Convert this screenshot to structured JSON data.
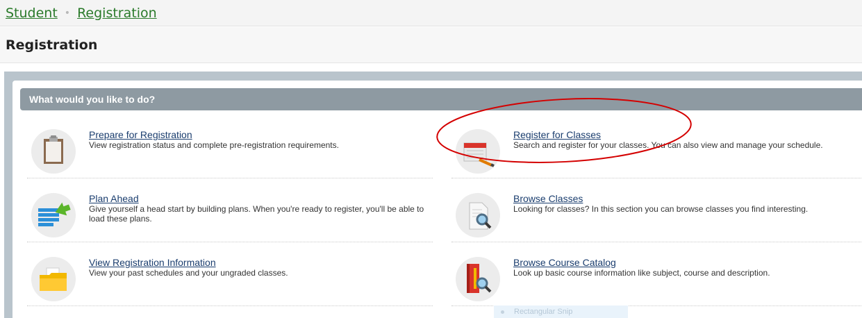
{
  "breadcrumb": {
    "items": [
      {
        "label": "Student"
      },
      {
        "label": "Registration"
      }
    ],
    "separator": "•"
  },
  "page_title": "Registration",
  "panel": {
    "header": "What would you like to do?"
  },
  "actions": {
    "prepare": {
      "title": "Prepare for Registration",
      "description": "View registration status and complete pre-registration requirements.",
      "icon": "clipboard-icon"
    },
    "register": {
      "title": "Register for Classes",
      "description": "Search and register for your classes. You can also view and manage your schedule.",
      "icon": "calendar-edit-icon"
    },
    "plan": {
      "title": "Plan Ahead",
      "description": "Give yourself a head start by building plans. When you're ready to register, you'll be able to load these plans.",
      "icon": "list-arrow-icon"
    },
    "browse": {
      "title": "Browse Classes",
      "description": "Looking for classes? In this section you can browse classes you find interesting.",
      "icon": "document-search-icon"
    },
    "view_info": {
      "title": "View Registration Information",
      "description": "View your past schedules and your ungraded classes.",
      "icon": "folder-icon"
    },
    "catalog": {
      "title": "Browse Course Catalog",
      "description": "Look up basic course information like subject, course and description.",
      "icon": "book-search-icon"
    }
  },
  "tooltip": {
    "label": "Rectangular Snip"
  },
  "colors": {
    "link_green": "#2a7a2a",
    "link_blue": "#1a3d6e",
    "panel_header": "#8e9aa2",
    "annotation_red": "#d40000"
  }
}
